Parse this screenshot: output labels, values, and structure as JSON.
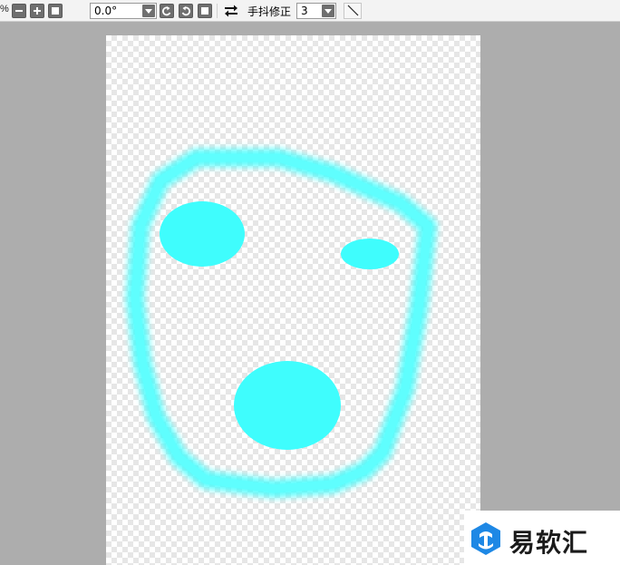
{
  "toolbar": {
    "zoom_suffix": "%",
    "angle_value": "0.0°",
    "stabilizer_label": "手抖修正",
    "stabilizer_value": "3"
  },
  "icons": {
    "zoom_out": "minus-icon",
    "zoom_in": "plus-icon",
    "fit": "square-icon",
    "rotate_left": "rotate-ccw-icon",
    "rotate_right": "rotate-cw-icon",
    "rotate_reset": "square-icon",
    "flip": "flip-horizontal-icon",
    "line": "line-tool-icon"
  },
  "colors": {
    "toolbar_bg": "#f3f3f3",
    "workspace_bg": "#adadad",
    "stroke_color": "#3ffdfd"
  },
  "watermark": {
    "text": "易软汇"
  }
}
